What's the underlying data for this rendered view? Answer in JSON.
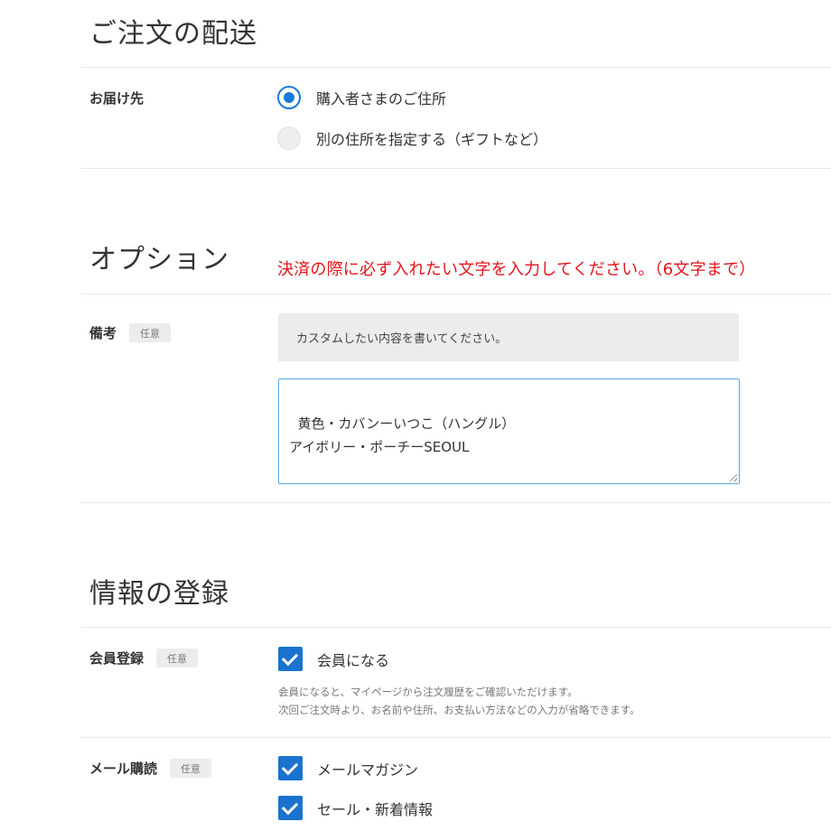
{
  "delivery": {
    "title": "ご注文の配送",
    "label": "お届け先",
    "options": [
      {
        "label": "購入者さまのご住所",
        "selected": true
      },
      {
        "label": "別の住所を指定する（ギフトなど）",
        "selected": false
      }
    ]
  },
  "option": {
    "title": "オプション",
    "notice": "決済の際に必ず入れたい文字を入力してください。（6文字まで）",
    "remarks_label": "備考",
    "optional_badge": "任意",
    "hint": "カスタムしたい内容を書いてください。",
    "memo_value": "黄色・カバンーいつこ（ハングル）\nアイボリー・ポーチーSEOUL"
  },
  "info": {
    "title": "情報の登録",
    "membership": {
      "label": "会員登録",
      "badge": "任意",
      "checkbox_label": "会員になる",
      "checked": true,
      "desc_line1": "会員になると、マイページから注文履歴をご確認いただけます。",
      "desc_line2": "次回ご注文時より、お名前や住所、お支払い方法などの入力が省略できます。"
    },
    "mail": {
      "label": "メール購読",
      "badge": "任意",
      "options": [
        {
          "label": "メールマガジン",
          "checked": true
        },
        {
          "label": "セール・新着情報",
          "checked": true
        }
      ]
    }
  },
  "colors": {
    "accent": "#1a7ad9",
    "notice": "#e3131b"
  }
}
